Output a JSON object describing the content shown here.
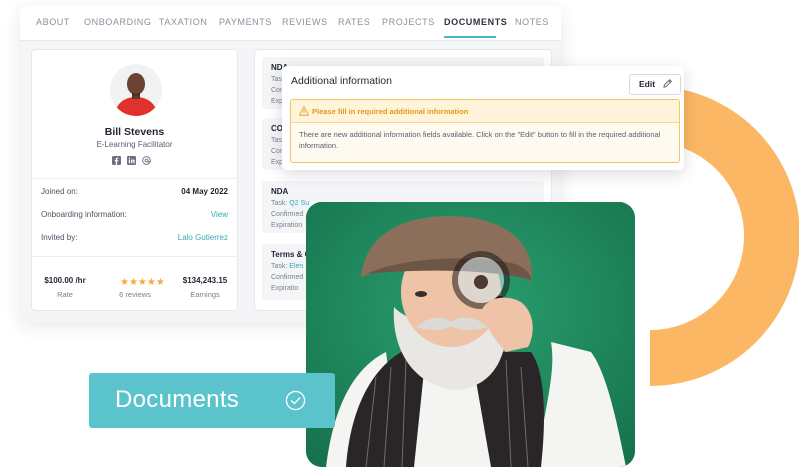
{
  "tabs": [
    "ABOUT",
    "ONBOARDING",
    "TAXATION",
    "PAYMENTS",
    "REVIEWS",
    "RATES",
    "PROJECTS",
    "DOCUMENTS",
    "NOTES"
  ],
  "active_tab": "DOCUMENTS",
  "profile": {
    "name": "Bill Stevens",
    "role": "E-Learning Facilitator",
    "social_icons": [
      "facebook-icon",
      "linkedin-icon",
      "at-icon"
    ],
    "rows": [
      {
        "label": "Joined on:",
        "value": "04 May 2022"
      },
      {
        "label": "Onboarding information:",
        "value": "View"
      },
      {
        "label": "Invited by:",
        "value": "Lalo Gutierrez"
      }
    ],
    "stats": {
      "rate_value": "$100.00 /hr",
      "rate_label": "Rate",
      "rating": 5,
      "reviews_label": "6 reviews",
      "earnings_value": "$134,243.15",
      "earnings_label": "Earnings"
    }
  },
  "documents": [
    {
      "title": "NDA",
      "task_label": "Task:",
      "task_link": "",
      "confirmed": "Con",
      "expiration": "Expira"
    },
    {
      "title": "CON",
      "task_label": "Task",
      "task_link": "",
      "confirmed": "Con",
      "expiration": "Expira"
    },
    {
      "title": "NDA",
      "task_label": "Task:",
      "task_link": "Q2 Su",
      "confirmed": "Confirmed",
      "expiration": "Expiration"
    },
    {
      "title": "Terms & C",
      "task_label": "Task:",
      "task_link": "Elen",
      "confirmed": "Confirmed",
      "expiration": "Expiratio"
    }
  ],
  "popup": {
    "title": "Additional information",
    "edit_label": "Edit",
    "warning_title": "Please fill in required additional information",
    "warning_text": "There are new additional information fields available. Click on the \"Edit\" button to fill in the required additional information."
  },
  "badge": {
    "label": "Documents"
  },
  "colors": {
    "accent": "#46b9c5",
    "badge": "#5bc3cc",
    "arc": "#fbb764",
    "warning": "#e39a1b",
    "photo_bg": "#1f8a5f"
  }
}
